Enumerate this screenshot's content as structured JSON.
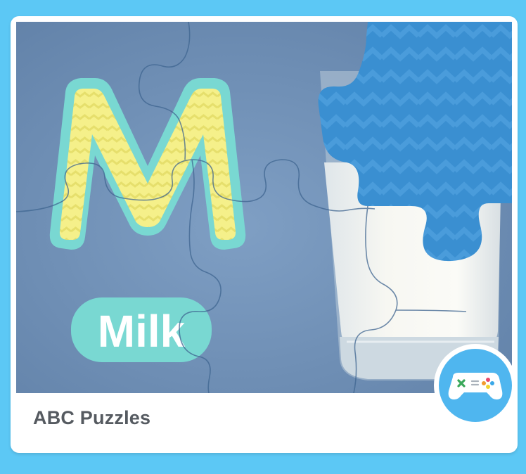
{
  "card": {
    "title": "ABC Puzzles",
    "image": {
      "letter": "M",
      "word": "Milk"
    },
    "badge_icon": "gamepad-icon"
  },
  "colors": {
    "page_background": "#5cc8f5",
    "image_background": "#6f8fb5",
    "letter_fill": "#f5f08a",
    "letter_outline": "#79d8d2",
    "puzzle_piece": "#3a8fd1",
    "badge": "#4fb6ef"
  }
}
